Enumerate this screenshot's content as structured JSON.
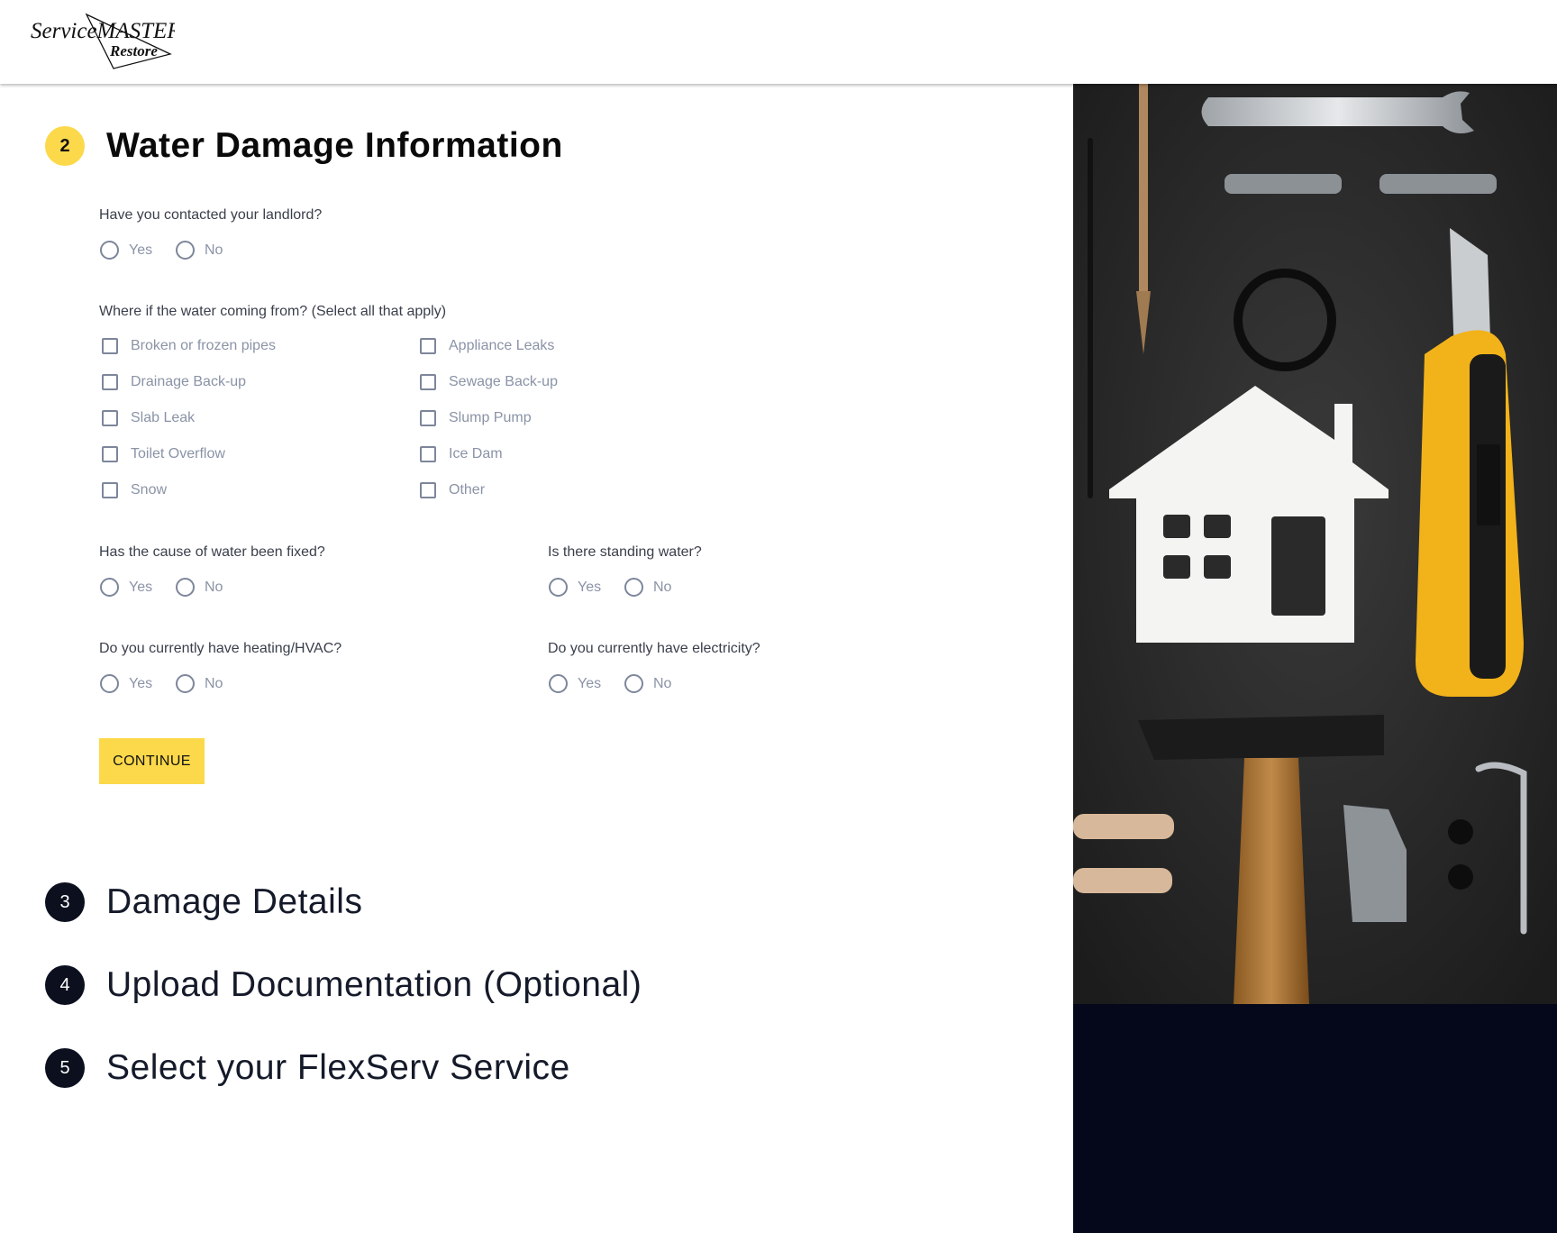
{
  "brand": {
    "logo_text_main": "ServiceMASTER",
    "logo_text_sub": "Restore"
  },
  "colors": {
    "accent": "#fcd94a",
    "dark": "#0b0f1e",
    "side_panel": "#05081a",
    "option_text": "#8a93a6"
  },
  "current_step": {
    "number": "2",
    "title": "Water Damage Information"
  },
  "questions": {
    "landlord": {
      "label": "Have you contacted your landlord?",
      "options": [
        "Yes",
        "No"
      ]
    },
    "water_source": {
      "label": "Where if the water coming from? (Select all that apply)",
      "left_options": [
        "Broken or frozen pipes",
        "Drainage Back-up",
        "Slab Leak",
        "Toilet Overflow",
        "Snow"
      ],
      "right_options": [
        "Appliance Leaks",
        "Sewage Back-up",
        "Slump Pump",
        "Ice Dam",
        "Other"
      ]
    },
    "cause_fixed": {
      "label": "Has the cause of water been fixed?",
      "options": [
        "Yes",
        "No"
      ]
    },
    "standing_water": {
      "label": "Is there standing water?",
      "options": [
        "Yes",
        "No"
      ]
    },
    "heating": {
      "label": "Do you currently have heating/HVAC?",
      "options": [
        "Yes",
        "No"
      ]
    },
    "electricity": {
      "label": "Do you currently have electricity?",
      "options": [
        "Yes",
        "No"
      ]
    }
  },
  "continue_label": "CONTINUE",
  "upcoming_steps": [
    {
      "number": "3",
      "title": "Damage Details"
    },
    {
      "number": "4",
      "title": "Upload Documentation (Optional)"
    },
    {
      "number": "5",
      "title": "Select your FlexServ Service"
    }
  ],
  "side_image": {
    "icon": "tools-and-house-photo"
  }
}
